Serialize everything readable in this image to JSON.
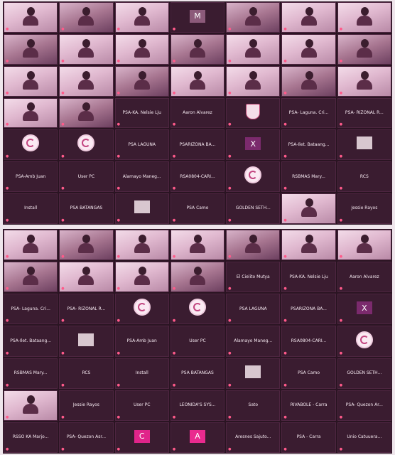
{
  "colors": {
    "background": "#efe6ec",
    "tile": "#3a1c30",
    "letter_m": "#8c5a7a",
    "letter_x": "#7b2a6d",
    "letter_c": "#e0248a",
    "letter_a": "#ea2a8f"
  },
  "panels": [
    {
      "tiles": [
        {
          "type": "video",
          "label": ""
        },
        {
          "type": "video",
          "label": ""
        },
        {
          "type": "video",
          "label": ""
        },
        {
          "type": "letter",
          "letter": "M",
          "color": "#8c5a7a",
          "label": ""
        },
        {
          "type": "video",
          "label": ""
        },
        {
          "type": "video",
          "label": ""
        },
        {
          "type": "video",
          "label": ""
        },
        {
          "type": "video",
          "label": ""
        },
        {
          "type": "video",
          "label": ""
        },
        {
          "type": "video",
          "label": ""
        },
        {
          "type": "video",
          "label": ""
        },
        {
          "type": "video",
          "label": ""
        },
        {
          "type": "video",
          "label": ""
        },
        {
          "type": "video",
          "label": ""
        },
        {
          "type": "video",
          "label": ""
        },
        {
          "type": "video",
          "label": ""
        },
        {
          "type": "video",
          "label": ""
        },
        {
          "type": "video",
          "label": ""
        },
        {
          "type": "video",
          "label": ""
        },
        {
          "type": "video",
          "label": ""
        },
        {
          "type": "video",
          "label": ""
        },
        {
          "type": "video",
          "label": ""
        },
        {
          "type": "video",
          "label": ""
        },
        {
          "type": "name",
          "name": "PSA-KA. Nelsie Lju",
          "label": ""
        },
        {
          "type": "name",
          "name": "Aaron Alvarez",
          "label": ""
        },
        {
          "type": "crest",
          "label": ""
        },
        {
          "type": "name",
          "name": "PSA- Laguna. Cri...",
          "label": ""
        },
        {
          "type": "name",
          "name": "PSA- RIZONAL R...",
          "label": ""
        },
        {
          "type": "logo",
          "label": ""
        },
        {
          "type": "logo",
          "label": ""
        },
        {
          "type": "name",
          "name": "PSA LAGUNA",
          "label": ""
        },
        {
          "type": "name",
          "name": "PSARIZONA BA...",
          "label": ""
        },
        {
          "type": "letter",
          "letter": "X",
          "color": "#7b2a6d",
          "label": ""
        },
        {
          "type": "name",
          "name": "PSA-Ilet. Bataang...",
          "label": ""
        },
        {
          "type": "thumb",
          "label": ""
        },
        {
          "type": "name",
          "name": "PSA-Amb Juan",
          "label": ""
        },
        {
          "type": "name",
          "name": "User PC",
          "label": ""
        },
        {
          "type": "name",
          "name": "Alamayo Maneg...",
          "label": ""
        },
        {
          "type": "name",
          "name": "RSA0804-CARI...",
          "label": ""
        },
        {
          "type": "logo",
          "label": ""
        },
        {
          "type": "name",
          "name": "RSBMAS Mary...",
          "label": ""
        },
        {
          "type": "name",
          "name": "RCS",
          "label": ""
        },
        {
          "type": "name",
          "name": "Install",
          "label": ""
        },
        {
          "type": "name",
          "name": "PSA BATANGAS",
          "label": ""
        },
        {
          "type": "thumb",
          "label": ""
        },
        {
          "type": "name",
          "name": "PSA Camo",
          "label": ""
        },
        {
          "type": "name",
          "name": "GOLDEN SETH...",
          "label": ""
        },
        {
          "type": "video",
          "label": ""
        },
        {
          "type": "name",
          "name": "Jessie Rayos",
          "label": ""
        }
      ]
    },
    {
      "tiles": [
        {
          "type": "video",
          "label": ""
        },
        {
          "type": "video",
          "label": ""
        },
        {
          "type": "video",
          "label": ""
        },
        {
          "type": "video",
          "label": ""
        },
        {
          "type": "video",
          "label": ""
        },
        {
          "type": "video",
          "label": ""
        },
        {
          "type": "video",
          "label": ""
        },
        {
          "type": "video",
          "label": ""
        },
        {
          "type": "video",
          "label": ""
        },
        {
          "type": "video",
          "label": ""
        },
        {
          "type": "video",
          "label": ""
        },
        {
          "type": "name",
          "name": "El Cielito Mutya",
          "label": ""
        },
        {
          "type": "name",
          "name": "PSA-KA. Nelsie Lju",
          "label": ""
        },
        {
          "type": "name",
          "name": "Aaron Alvarez",
          "label": ""
        },
        {
          "type": "name",
          "name": "PSA- Laguna. Cri...",
          "label": ""
        },
        {
          "type": "name",
          "name": "PSA- RIZONAL R...",
          "label": ""
        },
        {
          "type": "logo",
          "label": ""
        },
        {
          "type": "logo",
          "label": ""
        },
        {
          "type": "name",
          "name": "PSA LAGUNA",
          "label": ""
        },
        {
          "type": "name",
          "name": "PSARIZONA BA...",
          "label": ""
        },
        {
          "type": "letter",
          "letter": "X",
          "color": "#7b2a6d",
          "label": ""
        },
        {
          "type": "name",
          "name": "PSA-Ilet. Bataang...",
          "label": ""
        },
        {
          "type": "thumb",
          "label": ""
        },
        {
          "type": "name",
          "name": "PSA-Amb Juan",
          "label": ""
        },
        {
          "type": "name",
          "name": "User PC",
          "label": ""
        },
        {
          "type": "name",
          "name": "Alamayo Maneg...",
          "label": ""
        },
        {
          "type": "name",
          "name": "RSA0804-CARI...",
          "label": ""
        },
        {
          "type": "logo",
          "label": ""
        },
        {
          "type": "name",
          "name": "RSBMAS Mary...",
          "label": ""
        },
        {
          "type": "name",
          "name": "RCS",
          "label": ""
        },
        {
          "type": "name",
          "name": "Install",
          "label": ""
        },
        {
          "type": "name",
          "name": "PSA BATANGAS",
          "label": ""
        },
        {
          "type": "thumb",
          "label": ""
        },
        {
          "type": "name",
          "name": "PSA Camo",
          "label": ""
        },
        {
          "type": "name",
          "name": "GOLDEN SETH...",
          "label": ""
        },
        {
          "type": "video",
          "label": ""
        },
        {
          "type": "name",
          "name": "Jessie Rayos",
          "label": ""
        },
        {
          "type": "name",
          "name": "User PC",
          "label": ""
        },
        {
          "type": "name",
          "name": "LEONIDA'S SYS...",
          "label": ""
        },
        {
          "type": "name",
          "name": "Sato",
          "label": ""
        },
        {
          "type": "name",
          "name": "RIVABOLE - Carra",
          "label": ""
        },
        {
          "type": "name",
          "name": "PSA- Quezon Ar...",
          "label": ""
        },
        {
          "type": "name",
          "name": "RSSO KA Marjo...",
          "label": ""
        },
        {
          "type": "name",
          "name": "PSA- Quezon Asr...",
          "label": ""
        },
        {
          "type": "letter",
          "letter": "C",
          "color": "#e0248a",
          "label": ""
        },
        {
          "type": "letter",
          "letter": "A",
          "color": "#ea2a8f",
          "label": ""
        },
        {
          "type": "name",
          "name": "Aresnes Sajuto...",
          "label": ""
        },
        {
          "type": "name",
          "name": "PSA - Carra",
          "label": ""
        },
        {
          "type": "name",
          "name": "Unio Catuuera...",
          "label": ""
        }
      ]
    }
  ]
}
